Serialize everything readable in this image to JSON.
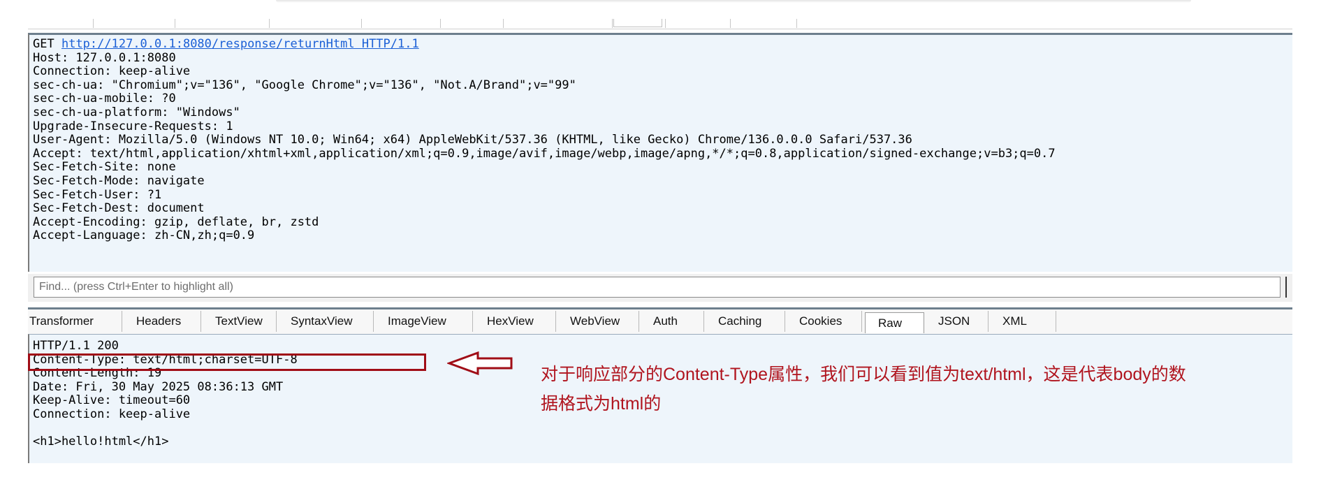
{
  "request": {
    "method": "GET",
    "url_line": "http://127.0.0.1:8080/response/returnHtml HTTP/1.1",
    "headers": [
      "Host: 127.0.0.1:8080",
      "Connection: keep-alive",
      "sec-ch-ua: \"Chromium\";v=\"136\", \"Google Chrome\";v=\"136\", \"Not.A/Brand\";v=\"99\"",
      "sec-ch-ua-mobile: ?0",
      "sec-ch-ua-platform: \"Windows\"",
      "Upgrade-Insecure-Requests: 1",
      "User-Agent: Mozilla/5.0 (Windows NT 10.0; Win64; x64) AppleWebKit/537.36 (KHTML, like Gecko) Chrome/136.0.0.0 Safari/537.36",
      "Accept: text/html,application/xhtml+xml,application/xml;q=0.9,image/avif,image/webp,image/apng,*/*;q=0.8,application/signed-exchange;v=b3;q=0.7",
      "Sec-Fetch-Site: none",
      "Sec-Fetch-Mode: navigate",
      "Sec-Fetch-User: ?1",
      "Sec-Fetch-Dest: document",
      "Accept-Encoding: gzip, deflate, br, zstd",
      "Accept-Language: zh-CN,zh;q=0.9"
    ]
  },
  "find": {
    "placeholder": "Find... (press Ctrl+Enter to highlight all)"
  },
  "response_tabs": [
    "Transformer",
    "Headers",
    "TextView",
    "SyntaxView",
    "ImageView",
    "HexView",
    "WebView",
    "Auth",
    "Caching",
    "Cookies",
    "Raw",
    "JSON",
    "XML"
  ],
  "active_tab": "Raw",
  "response": {
    "lines": [
      "HTTP/1.1 200",
      "Content-Type: text/html;charset=UTF-8",
      "Content-Length: 19",
      "Date: Fri, 30 May 2025 08:36:13 GMT",
      "Keep-Alive: timeout=60",
      "Connection: keep-alive",
      "",
      "<h1>hello!html</h1>"
    ]
  },
  "annotation": {
    "line1": "对于响应部分的Content-Type属性，我们可以看到值为text/html，这是代表body的数",
    "line2": "据格式为html的",
    "color": "#b0141e"
  }
}
